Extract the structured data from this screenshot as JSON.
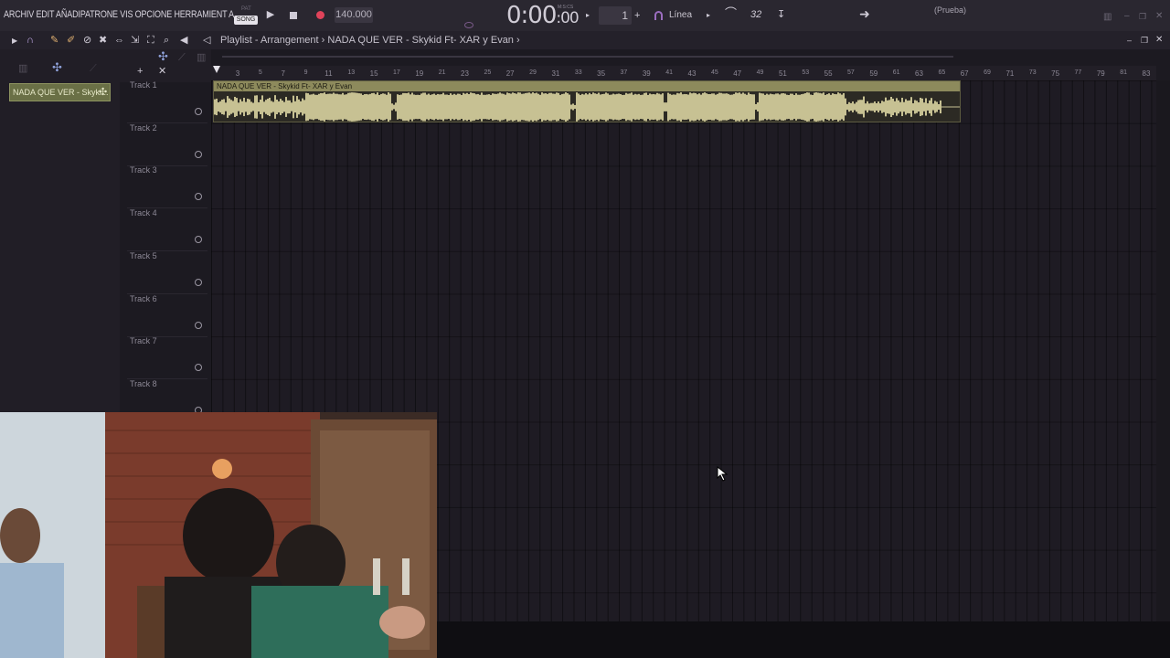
{
  "menu": {
    "items": [
      "ARCHIV",
      "EDIT",
      "AÑADI",
      "PATRONE",
      "VIS",
      "OPCIONE",
      "HERRAMIENT",
      "A"
    ]
  },
  "transport": {
    "mode_pat": "PAT",
    "mode_song": "SONG",
    "tempo": "140.000",
    "time_main": "0:00",
    "time_sub": ":00",
    "time_units": "M:S:CS",
    "pattern_number": "1",
    "snap": "Línea",
    "cpu": "32"
  },
  "prueba": "(Prueba)",
  "playlist": {
    "breadcrumb": "Playlist - Arrangement › NADA QUE VER - Skykid Ft- XAR y Evan ›"
  },
  "picker": {
    "clip_name": "NADA QUE VER - Skyki..."
  },
  "tracks": [
    "Track 1",
    "Track 2",
    "Track 3",
    "Track 4",
    "Track 5",
    "Track 6",
    "Track 7",
    "Track 8"
  ],
  "ruler": {
    "bars": [
      "3",
      "5",
      "7",
      "9",
      "11",
      "13",
      "15",
      "17",
      "19",
      "21",
      "23",
      "25",
      "27",
      "29",
      "31",
      "33",
      "35",
      "37",
      "39",
      "41",
      "43",
      "45",
      "47",
      "49",
      "51",
      "53",
      "55",
      "57",
      "59",
      "61",
      "63",
      "65",
      "67",
      "69",
      "71",
      "73",
      "75",
      "77",
      "79",
      "81",
      "83"
    ]
  },
  "audio_clip": {
    "title": "NADA QUE VER - Skykid Ft- XAR y Evan"
  },
  "colors": {
    "clip_head": "#8d8a5c",
    "waveform": "#c7c193",
    "record": "#e0435a",
    "background": "#1e1b23"
  }
}
